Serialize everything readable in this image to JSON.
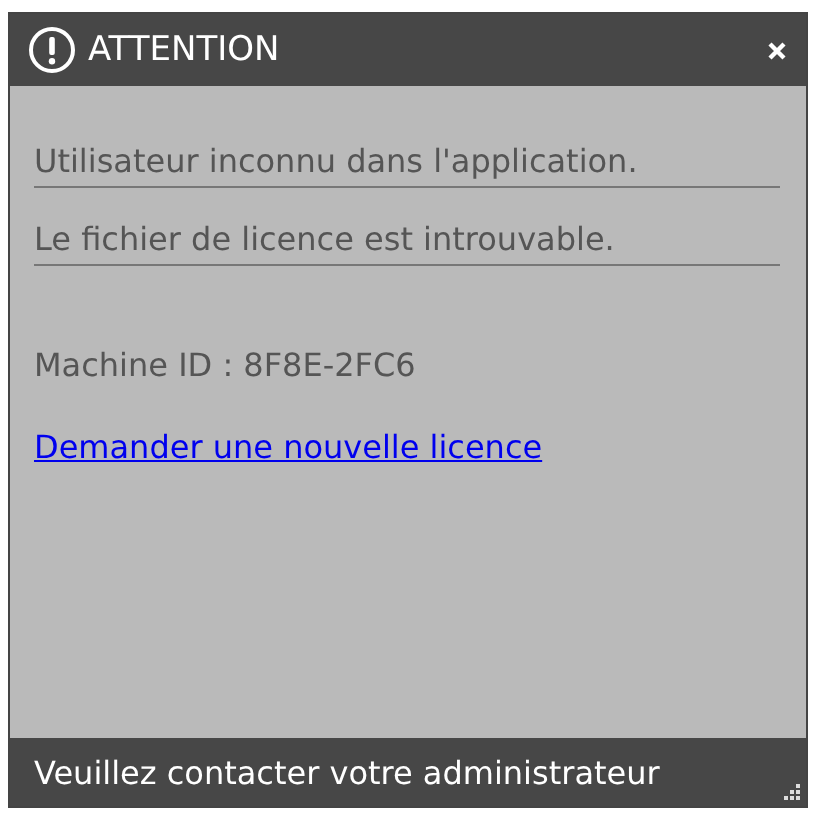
{
  "window": {
    "title": "ATTENTION"
  },
  "messages": [
    "Utilisateur inconnu dans l'application.",
    "Le fichier de licence est introuvable."
  ],
  "machine_id": "Machine ID : 8F8E-2FC6",
  "link": "Demander une nouvelle licence",
  "footer": "Veuillez contacter votre administrateur"
}
